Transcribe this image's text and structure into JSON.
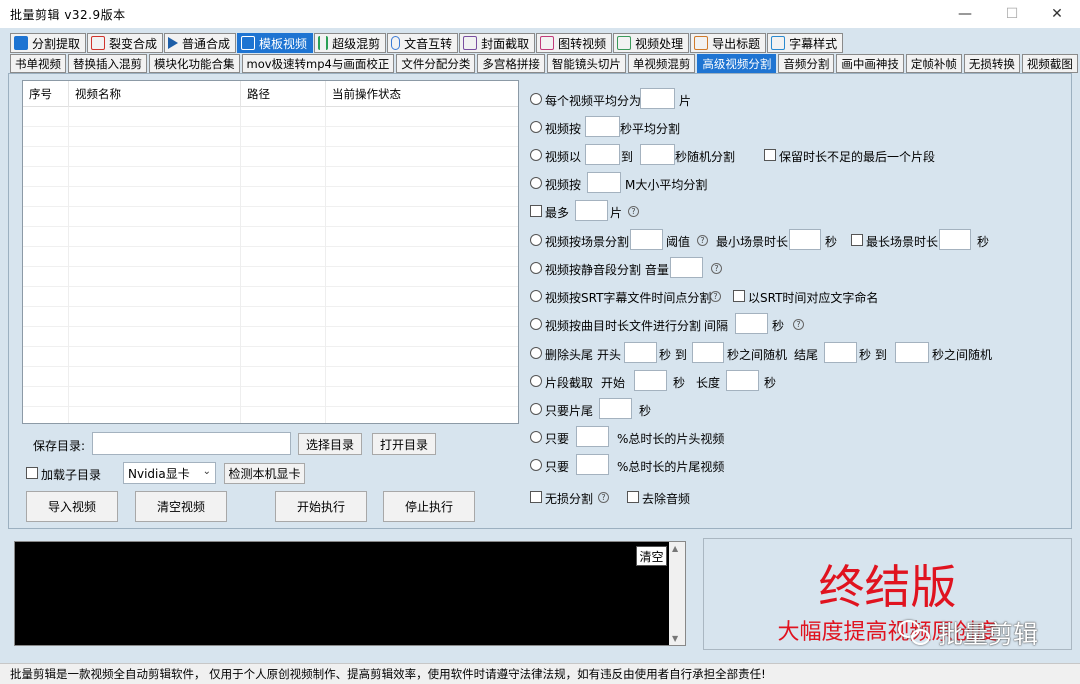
{
  "window": {
    "title": "批量剪辑   v32.9版本",
    "minimize": "—",
    "maximize": "☐",
    "close": "✕"
  },
  "main_tabs": [
    {
      "label": "分割提取",
      "color": "#1e74d2"
    },
    {
      "label": "裂变合成",
      "color": "#d0342c"
    },
    {
      "label": "普通合成",
      "color": "#1e5fa8"
    },
    {
      "label": "模板视频",
      "color": "#ffffff"
    },
    {
      "label": "超级混剪",
      "color": "#2aa055"
    },
    {
      "label": "文音互转",
      "color": "#3b7bd6"
    },
    {
      "label": "封面截取",
      "color": "#7a4fa0"
    },
    {
      "label": "图转视频",
      "color": "#c03a7a"
    },
    {
      "label": "视频处理",
      "color": "#3a9a5a"
    },
    {
      "label": "导出标题",
      "color": "#d07a2a"
    },
    {
      "label": "字幕样式",
      "color": "#2a8ad0"
    }
  ],
  "sub_tabs": [
    "书单视频",
    "替换插入混剪",
    "模块化功能合集",
    "mov极速转mp4与画面校正",
    "文件分配分类",
    "多宫格拼接",
    "智能镜头切片",
    "单视频混剪",
    "高级视频分割",
    "音频分割",
    "画中画神技",
    "定帧补帧",
    "无损转换",
    "视频截图"
  ],
  "table": {
    "headers": [
      "序号",
      "视频名称",
      "路径",
      "当前操作状态"
    ]
  },
  "save": {
    "label": "保存目录:",
    "value": "",
    "select_dir": "选择目录",
    "open_dir": "打开目录"
  },
  "subdir": {
    "label": "加载子目录",
    "gpu_value": "Nvidia显卡",
    "detect": "检测本机显卡"
  },
  "buttons": {
    "import": "导入视频",
    "clear": "清空视频",
    "start": "开始执行",
    "stop": "停止执行"
  },
  "options": {
    "o1": {
      "a": "每个视频平均分为",
      "b": "片"
    },
    "o2": {
      "a": "视频按",
      "b": "秒平均分割"
    },
    "o3": {
      "a": "视频以",
      "b": "到",
      "c": "秒随机分割",
      "d": "保留时长不足的最后一个片段"
    },
    "o4": {
      "a": "视频按",
      "b": "M大小平均分割"
    },
    "o5": {
      "a": "最多",
      "b": "片"
    },
    "o6": {
      "a": "视频按场景分割",
      "b": "阈值",
      "c": "最小场景时长",
      "d": "秒",
      "e": "最长场景时长",
      "f": "秒"
    },
    "o7": {
      "a": "视频按静音段分割 音量"
    },
    "o8": {
      "a": "视频按SRT字幕文件时间点分割",
      "b": "以SRT时间对应文字命名"
    },
    "o9": {
      "a": "视频按曲目时长文件进行分割",
      "b": "间隔",
      "c": "秒"
    },
    "o10": {
      "a": "删除头尾",
      "b": "开头",
      "c": "秒 到",
      "d": "秒之间随机",
      "e": "结尾",
      "f": "秒 到",
      "g": "秒之间随机"
    },
    "o11": {
      "a": "片段截取",
      "b": "开始",
      "c": "秒",
      "d": "长度",
      "e": "秒"
    },
    "o12": {
      "a": "只要片尾",
      "b": "秒"
    },
    "o13": {
      "a": "只要",
      "b": "%总时长的片头视频"
    },
    "o14": {
      "a": "只要",
      "b": "%总时长的片尾视频"
    },
    "o15": {
      "a": "无损分割",
      "b": "去除音频"
    }
  },
  "console": {
    "clear": "清空"
  },
  "promo": {
    "title": "终结版",
    "subtitle": "大幅度提高视频原创度"
  },
  "watermark": {
    "text": "批量剪辑"
  },
  "status": "批量剪辑是一款视频全自动剪辑软件， 仅用于个人原创视频制作、提高剪辑效率，使用软件时请遵守法律法规，如有违反由使用者自行承担全部责任!"
}
